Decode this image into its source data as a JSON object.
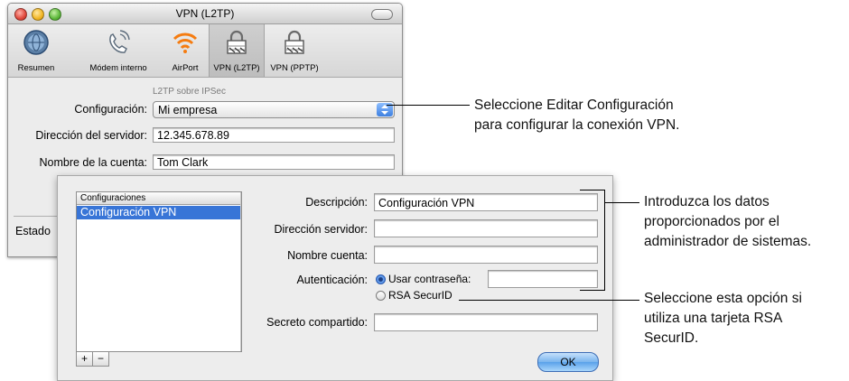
{
  "window": {
    "title": "VPN (L2TP)",
    "toolbar": [
      {
        "label": "Resumen",
        "icon": "network-globe-icon"
      },
      {
        "label": "Módem interno",
        "icon": "phone-modem-icon"
      },
      {
        "label": "AirPort",
        "icon": "airport-wifi-icon"
      },
      {
        "label": "VPN (L2TP)",
        "icon": "vpn-lock-icon",
        "selected": true
      },
      {
        "label": "VPN (PPTP)",
        "icon": "vpn-lock-icon"
      }
    ],
    "section_caption": "L2TP sobre IPSec",
    "config_label": "Configuración:",
    "config_value": "Mi empresa",
    "server_label": "Dirección del servidor:",
    "server_value": "12.345.678.89",
    "account_label": "Nombre de la cuenta:",
    "account_value": "Tom Clark",
    "status_label": "Estado"
  },
  "sheet": {
    "list_header": "Configuraciones",
    "list_items": [
      "Configuración VPN"
    ],
    "description_label": "Descripción:",
    "description_value": "Configuración VPN",
    "server_label": "Dirección servidor:",
    "server_value": "",
    "account_label": "Nombre cuenta:",
    "account_value": "",
    "auth_label": "Autenticación:",
    "auth_password_option": "Usar contraseña:",
    "auth_password_value": "",
    "auth_securid_option": "RSA SecurID",
    "shared_secret_label": "Secreto compartido:",
    "shared_secret_value": "",
    "add_label": "+",
    "remove_label": "−",
    "ok_label": "OK"
  },
  "callouts": {
    "c1_line1": "Seleccione Editar Configuración",
    "c1_line2": "para configurar la conexión VPN.",
    "c2_line1": "Introduzca los datos",
    "c2_line2": "proporcionados por el",
    "c2_line3": "administrador de sistemas.",
    "c3_line1": "Seleccione esta opción si",
    "c3_line2": "utiliza una tarjeta RSA",
    "c3_line3": "SecurID."
  },
  "colors": {
    "selection": "#3875d7",
    "ok_button": "#79b4ee"
  }
}
